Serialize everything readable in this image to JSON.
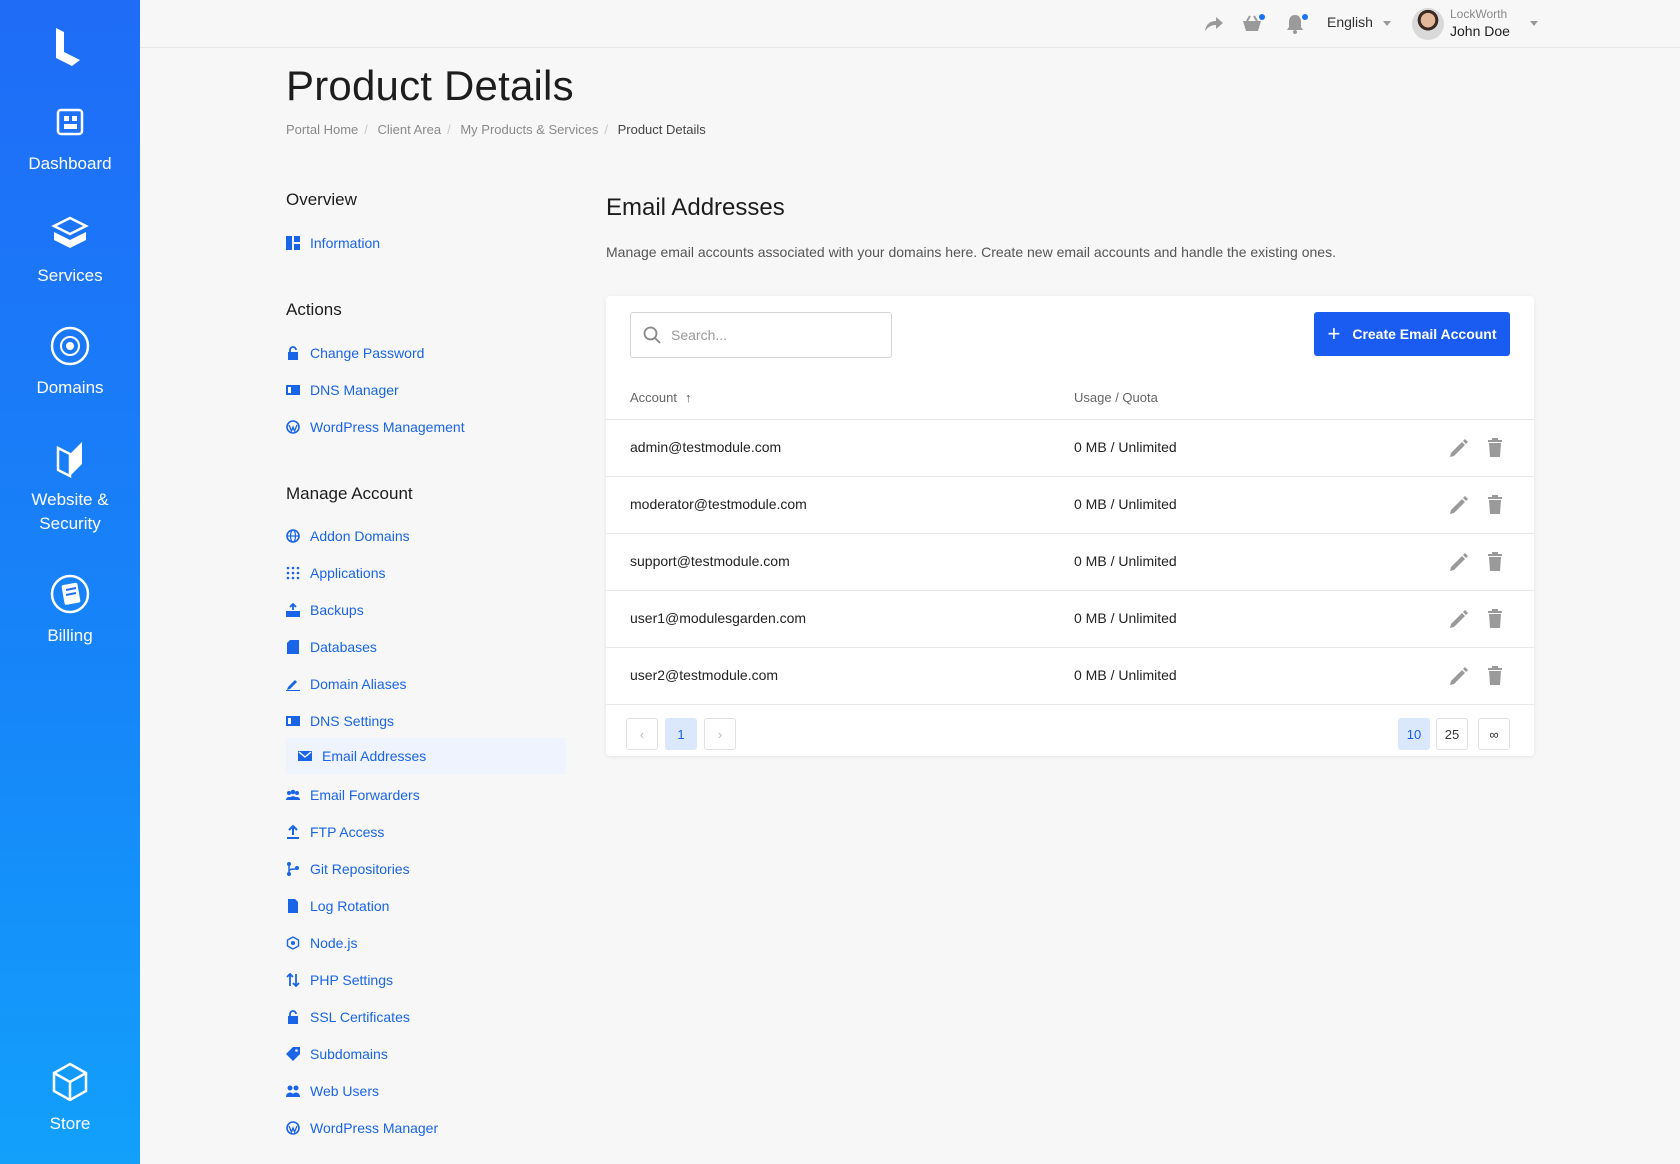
{
  "sidebar": {
    "items": [
      {
        "label": "Dashboard",
        "icon": "dashboard-icon"
      },
      {
        "label": "Services",
        "icon": "services-icon"
      },
      {
        "label": "Domains",
        "icon": "domains-icon"
      },
      {
        "label": "Website &\nSecurity",
        "icon": "website-security-icon"
      },
      {
        "label": "Billing",
        "icon": "billing-icon"
      },
      {
        "label": "Store",
        "icon": "store-icon"
      }
    ]
  },
  "topbar": {
    "language": "English",
    "user_org": "LockWorth",
    "user_name": "John Doe"
  },
  "header": {
    "title": "Product Details",
    "breadcrumb": [
      "Portal Home",
      "Client Area",
      "My Products & Services",
      "Product Details"
    ]
  },
  "menu": {
    "overview_heading": "Overview",
    "overview_items": [
      "Information"
    ],
    "actions_heading": "Actions",
    "actions_items": [
      "Change Password",
      "DNS Manager",
      "WordPress Management"
    ],
    "manage_heading": "Manage Account",
    "manage_items": [
      "Addon Domains",
      "Applications",
      "Backups",
      "Databases",
      "Domain Aliases",
      "DNS Settings",
      "Email Addresses",
      "Email Forwarders",
      "FTP Access",
      "Git Repositories",
      "Log Rotation",
      "Node.js",
      "PHP Settings",
      "SSL Certificates",
      "Subdomains",
      "Web Users",
      "WordPress Manager"
    ]
  },
  "main": {
    "title": "Email Addresses",
    "description": "Manage email accounts associated with your domains here. Create new email accounts and handle the existing ones.",
    "search_placeholder": "Search...",
    "create_label": "Create Email Account",
    "columns": {
      "account": "Account",
      "usage": "Usage / Quota"
    },
    "rows": [
      {
        "account": "admin@testmodule.com",
        "usage": "0 MB / Unlimited"
      },
      {
        "account": "moderator@testmodule.com",
        "usage": "0 MB / Unlimited"
      },
      {
        "account": "support@testmodule.com",
        "usage": "0 MB / Unlimited"
      },
      {
        "account": "user1@modulesgarden.com",
        "usage": "0 MB / Unlimited"
      },
      {
        "account": "user2@testmodule.com",
        "usage": "0 MB / Unlimited"
      }
    ],
    "pager": {
      "prev": "‹",
      "page": "1",
      "next": "›",
      "sizes": [
        "10",
        "25",
        "∞"
      ]
    }
  },
  "colors": {
    "accent": "#1a5cf2",
    "link": "#1a64e8",
    "sidebar": "#1f6cf7"
  }
}
